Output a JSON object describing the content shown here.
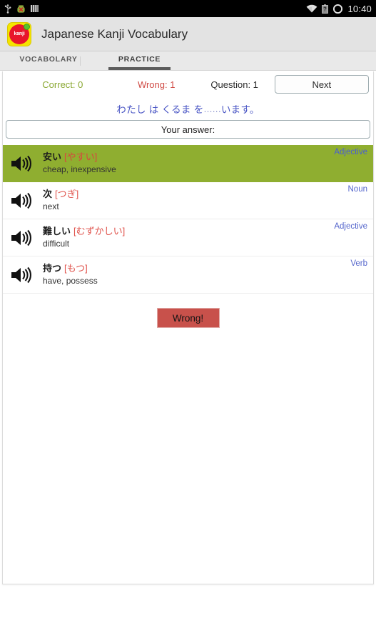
{
  "statusbar": {
    "time": "10:40",
    "left_icons": [
      "usb-icon",
      "adb-icon",
      "signal-bars-icon"
    ],
    "right_icons": [
      "wifi-icon",
      "unknown-battery-icon",
      "rotation-circle-icon"
    ]
  },
  "actionbar": {
    "title": "Japanese Kanji Vocabulary",
    "logo_text": "kanji"
  },
  "tabs": [
    {
      "label": "VOCABOLARY",
      "active": false
    },
    {
      "label": "PRACTICE",
      "active": true
    }
  ],
  "score": {
    "correct": "Correct: 0",
    "wrong": "Wrong: 1",
    "question": "Question: 1",
    "next_label": "Next",
    "correct_color": "#8aa832",
    "wrong_color": "#d04b45"
  },
  "question": {
    "prefix": "わたし は くるま を ",
    "blank": "......",
    "suffix": " います。"
  },
  "answer": {
    "label": "Your answer:",
    "value": ""
  },
  "vocabulary": [
    {
      "kanji": "安い",
      "kana": "[やすい]",
      "meaning": "cheap, inexpensive",
      "type": "Adjective",
      "selected": true
    },
    {
      "kanji": "次",
      "kana": "[つぎ]",
      "meaning": "next",
      "type": "Noun",
      "selected": false
    },
    {
      "kanji": "難しい",
      "kana": "[むずかしい]",
      "meaning": "difficult",
      "type": "Adjective",
      "selected": false
    },
    {
      "kanji": "持つ",
      "kana": "[もつ]",
      "meaning": "have, possess",
      "type": "Verb",
      "selected": false
    }
  ],
  "result": {
    "label": "Wrong!",
    "color": "#c8514b"
  },
  "colors": {
    "selected_row": "#8fae30",
    "accent_blue": "#4854c4",
    "kana_red": "#e0534c"
  }
}
